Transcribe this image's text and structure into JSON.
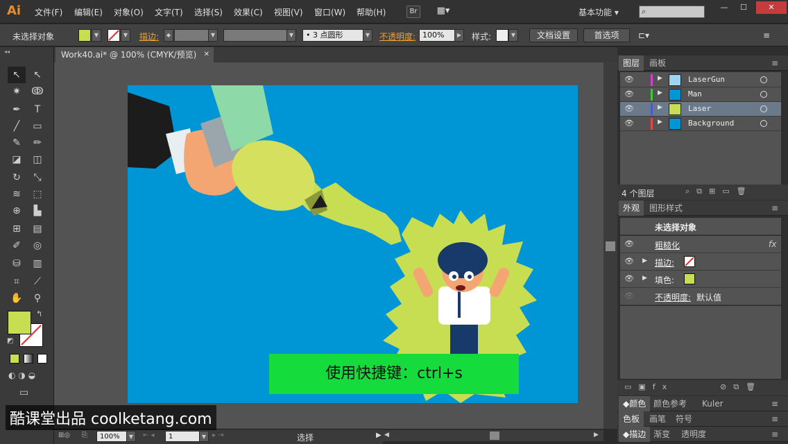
{
  "app": {
    "logo": "Ai",
    "menu": [
      "文件(F)",
      "编辑(E)",
      "对象(O)",
      "文字(T)",
      "选择(S)",
      "效果(C)",
      "视图(V)",
      "窗口(W)",
      "帮助(H)"
    ],
    "bridge_button": "Br",
    "workspace": "基本功能",
    "window_controls": [
      "—",
      "☐",
      "✕"
    ]
  },
  "control_bar": {
    "selection_label": "未选择对象",
    "fill_color": "#c8de52",
    "stroke_label": "描边:",
    "brush_value": "3 点圆形",
    "opacity_label": "不透明度:",
    "opacity_value": "100%",
    "style_label": "样式:",
    "doc_settings_button": "文档设置",
    "preferences_button": "首选项"
  },
  "document": {
    "tab_title": "Work40.ai* @ 100% (CMYK/预览)",
    "close": "✕"
  },
  "status_bar": {
    "zoom": "100%",
    "artboard_number": "1",
    "tool_status": "选择"
  },
  "layers_panel": {
    "tabs": [
      "图层",
      "画板"
    ],
    "layers": [
      {
        "name": "LaserGun",
        "color": "#c844c8",
        "thumb": "#9fd4f0"
      },
      {
        "name": "Man",
        "color": "#3cc83c",
        "thumb": "#0096d6"
      },
      {
        "name": "Laser",
        "color": "#4a5ac8",
        "thumb": "#c8de52"
      },
      {
        "name": "Background",
        "color": "#e04848",
        "thumb": "#0096d6"
      }
    ],
    "count": "4 个图层"
  },
  "appearance_panel": {
    "tabs": [
      "外观",
      "图形样式"
    ],
    "title": "未选择对象",
    "effect": "粗糙化",
    "stroke_label": "描边:",
    "fill_label": "填色:",
    "opacity_label": "不透明度:",
    "opacity_value": "默认值",
    "fill_color": "#c8de52"
  },
  "bottom_panels": [
    {
      "tabs": [
        "颜色",
        "颜色参考",
        "Kuler"
      ]
    },
    {
      "tabs": [
        "色板",
        "画笔",
        "符号"
      ]
    },
    {
      "tabs": [
        "描边",
        "渐变",
        "透明度"
      ]
    }
  ],
  "overlay": {
    "shortcut_text": "使用快捷键：ctrl+s",
    "watermark": "酷课堂出品 coolketang.com"
  },
  "colors": {
    "artboard_bg": "#0096d6",
    "accent_orange": "#e98c2d",
    "laser_yellow": "#c8de52",
    "overlay_green": "#15dc3c"
  }
}
